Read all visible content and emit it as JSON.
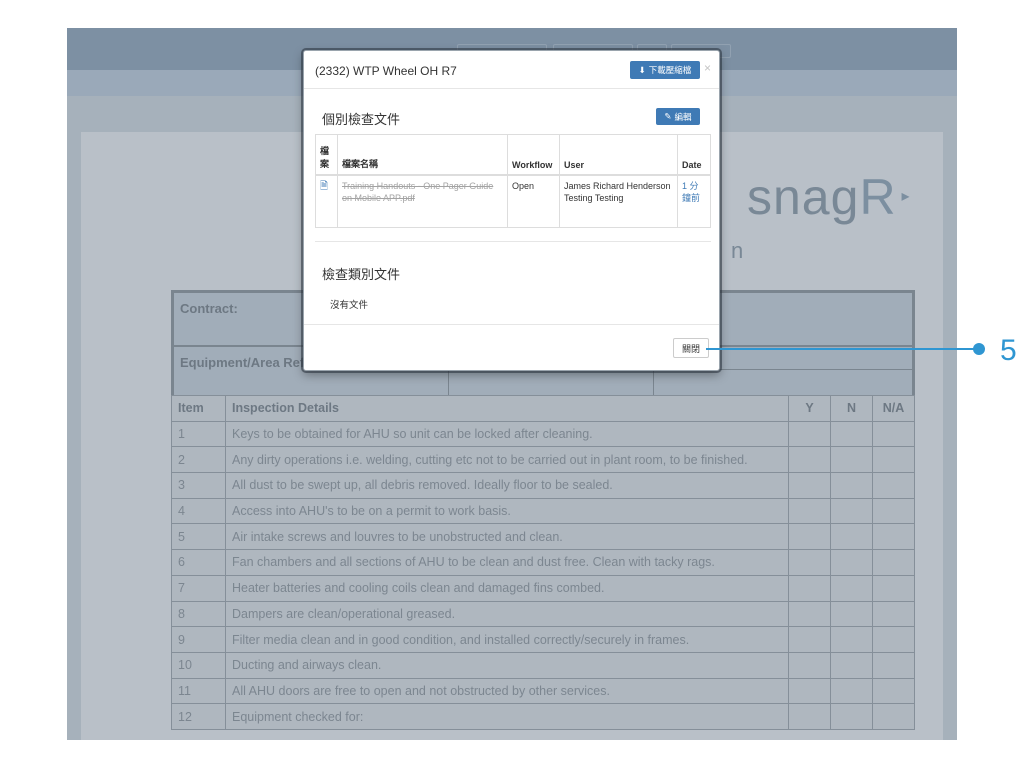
{
  "background": {
    "logo_text": "snag",
    "logo_r": "R",
    "subtitle_fragment": "n",
    "contract_label": "Contract:",
    "equipment_label": "Equipment/Area Ref",
    "inspection": {
      "headers": [
        "Item",
        "Inspection Details",
        "Y",
        "N",
        "N/A"
      ],
      "rows": [
        {
          "num": "1",
          "text": "Keys to be obtained for AHU so unit can be locked after cleaning."
        },
        {
          "num": "2",
          "text": "Any dirty operations i.e. welding, cutting etc not to be carried out in plant room, to be finished."
        },
        {
          "num": "3",
          "text": "All dust to be swept up, all debris removed.  Ideally floor to be sealed."
        },
        {
          "num": "4",
          "text": "Access into AHU's to be on a permit to work basis."
        },
        {
          "num": "5",
          "text": "Air intake screws and louvres to be unobstructed and clean."
        },
        {
          "num": "6",
          "text": "Fan chambers and all sections of AHU to be clean and dust free.  Clean with tacky rags."
        },
        {
          "num": "7",
          "text": "Heater batteries and cooling coils clean and damaged fins combed."
        },
        {
          "num": "8",
          "text": "Dampers are clean/operational greased."
        },
        {
          "num": "9",
          "text": "Filter media clean and in good condition, and installed correctly/securely in frames."
        },
        {
          "num": "10",
          "text": "Ducting and airways clean."
        },
        {
          "num": "11",
          "text": "All AHU doors are free to open and not obstructed by other services."
        },
        {
          "num": "12",
          "text": "Equipment checked for:"
        }
      ]
    }
  },
  "modal": {
    "title": "(2332) WTP Wheel OH R7",
    "download_label": "下載壓縮檔",
    "close_x": "×",
    "section_individual": "個別檢查文件",
    "edit_label": "編輯",
    "table": {
      "headers": {
        "file": "檔案",
        "name": "檔案名稱",
        "workflow": "Workflow",
        "user": "User",
        "date": "Date"
      },
      "rows": [
        {
          "icon": "pdf-file-icon",
          "name": "Training Handouts - One Pager Guide on Mobile APP.pdf",
          "workflow": "Open",
          "user": "James Richard Henderson Testing Testing",
          "date": "1 分鐘前"
        }
      ]
    },
    "section_category": "檢查類別文件",
    "no_docs": "沒有文件",
    "close_button": "關閉"
  },
  "callout": {
    "number": "5",
    "color": "#2f96d2"
  },
  "colors": {
    "primary_button": "#3f7ab5",
    "callout": "#2f96d2"
  }
}
